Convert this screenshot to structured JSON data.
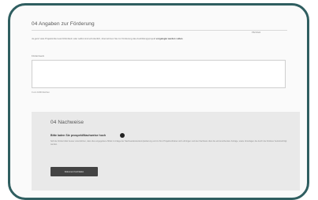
{
  "form": {
    "section1_title": "04 Angaben zur Förderung",
    "required_note": "Pflichtfeld",
    "description_lead": "Ja ganz viele Projektmittel aus Drittmitteln oder selbst sind erforderlich, übernehmen Sie zur Förderung das Ausbildungsprojekt",
    "description_bold": "vorgelegte werden sollen.",
    "field_label": "Förderzweck",
    "textarea_value": "",
    "counter": "0 von 1000 Zeichen"
  },
  "evidence": {
    "section2_title": "04 Nachweise",
    "upload_label": "Bitte laden Sie prospekt/Nachweise hoch",
    "upload_description": "Soll die Fördermittel besser unterstützen, dass dies angegebene Mittel in Anlage der Nachweiskostenkomplettierung und zu Ihrer Projektvorhaben sich erbringen und den Nachweis über die einzureichenden Anträge, sowie Unterlagen die durch die Förderer berücksichtigt werden.",
    "upload_button": "Dokument hochladen"
  }
}
